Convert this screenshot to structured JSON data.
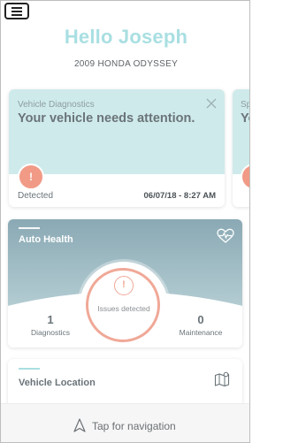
{
  "header": {
    "greeting": "Hello Joseph",
    "vehicle": "2009 HONDA ODYSSEY"
  },
  "diagnostics_card": {
    "title": "Vehicle Diagnostics",
    "message": "Your vehicle needs attention.",
    "status": "Detected",
    "timestamp": "06/07/18 - 8:27 AM",
    "alert_icon": "!"
  },
  "peek_card": {
    "title": "Sp",
    "message": "Yo"
  },
  "auto_health": {
    "title": "Auto Health",
    "issues_label": "Issues detected",
    "issues_icon": "!",
    "diagnostics_value": "1",
    "diagnostics_label": "Diagnostics",
    "maintenance_value": "0",
    "maintenance_label": "Maintenance"
  },
  "location_card": {
    "title": "Vehicle Location"
  },
  "nav": {
    "label": "Tap for navigation"
  },
  "colors": {
    "accent_teal": "#a9dfe2",
    "alert_salmon": "#f19a86",
    "health_bg": "#8fb3be"
  }
}
